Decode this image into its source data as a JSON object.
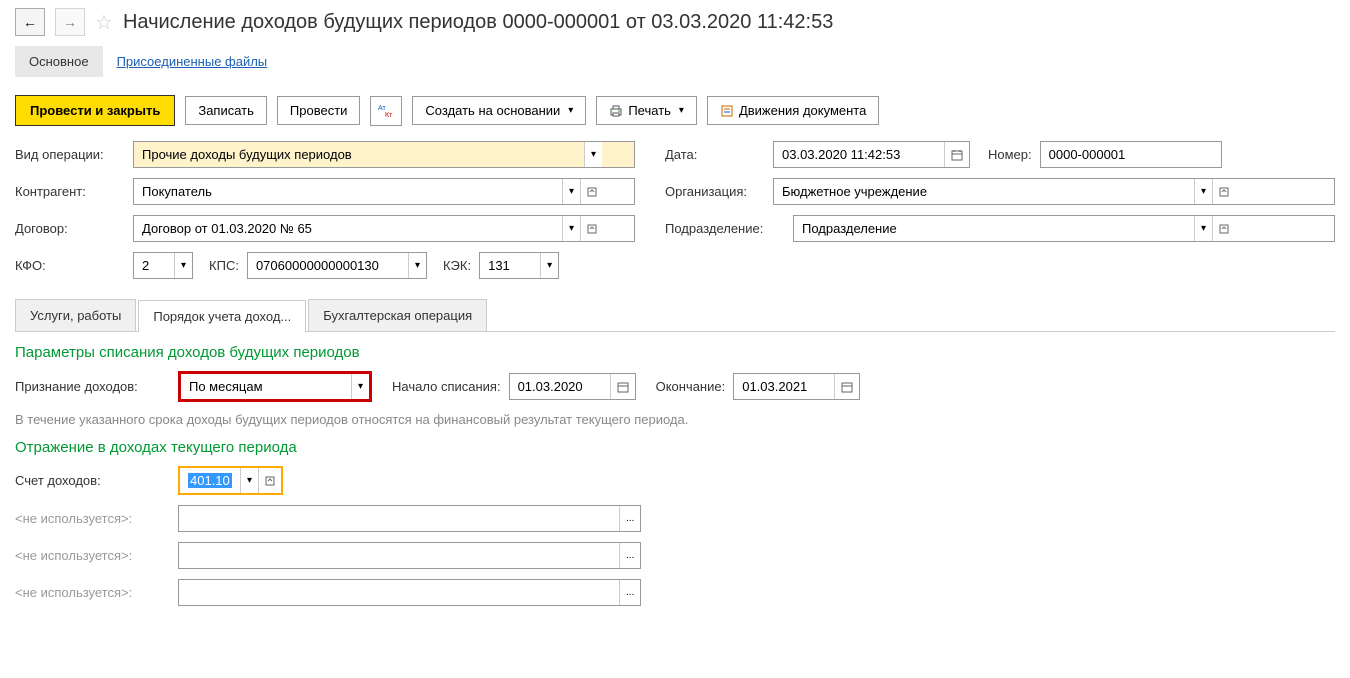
{
  "header": {
    "title": "Начисление доходов будущих периодов 0000-000001 от 03.03.2020 11:42:53"
  },
  "navTabs": {
    "main": "Основное",
    "files": "Присоединенные файлы"
  },
  "toolbar": {
    "postClose": "Провести и закрыть",
    "save": "Записать",
    "post": "Провести",
    "createBased": "Создать на основании",
    "print": "Печать",
    "movements": "Движения документа"
  },
  "labels": {
    "opType": "Вид операции:",
    "date": "Дата:",
    "number": "Номер:",
    "counterparty": "Контрагент:",
    "org": "Организация:",
    "contract": "Договор:",
    "division": "Подразделение:",
    "kfo": "КФО:",
    "kps": "КПС:",
    "kek": "КЭК:",
    "recognition": "Признание доходов:",
    "startWriteOff": "Начало списания:",
    "endDate": "Окончание:",
    "incomeAccount": "Счет доходов:",
    "notUsed": "<не используется>:"
  },
  "values": {
    "opType": "Прочие доходы будущих периодов",
    "date": "03.03.2020 11:42:53",
    "number": "0000-000001",
    "counterparty": "Покупатель",
    "org": "Бюджетное учреждение",
    "contract": "Договор от 01.03.2020 № 65",
    "division": "Подразделение",
    "kfo": "2",
    "kps": "07060000000000130",
    "kek": "131",
    "recognition": "По месяцам",
    "startWriteOff": "01.03.2020",
    "endDate": "01.03.2021",
    "incomeAccount": "401.10"
  },
  "subTabs": {
    "services": "Услуги, работы",
    "incomeOrder": "Порядок учета доход...",
    "accounting": "Бухгалтерская операция"
  },
  "sections": {
    "writeOffParams": "Параметры списания доходов будущих периодов",
    "hint": "В течение указанного срока доходы будущих периодов относятся на финансовый результат текущего периода.",
    "currentIncome": "Отражение в доходах текущего периода"
  }
}
